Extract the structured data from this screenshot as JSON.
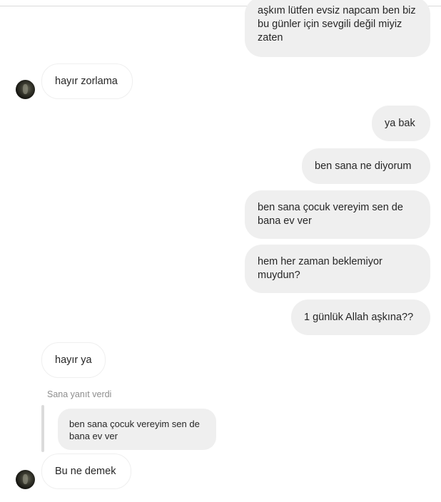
{
  "messages": {
    "m1": "aşkım lütfen evsiz napcam ben biz bu günler için sevgili değil miyiz zaten",
    "m2": "hayır zorlama",
    "m3": "ya bak",
    "m4": "ben sana ne diyorum",
    "m5": "ben sana çocuk vereyim sen de bana ev ver",
    "m6": "hem her zaman beklemiyor muydun?",
    "m7": "1 günlük Allah aşkına??",
    "m8": "hayır ya",
    "m9": "Bu ne demek"
  },
  "reply": {
    "note": "Sana yanıt verdi",
    "quoted": "ben sana çocuk vereyim sen de bana ev ver"
  }
}
